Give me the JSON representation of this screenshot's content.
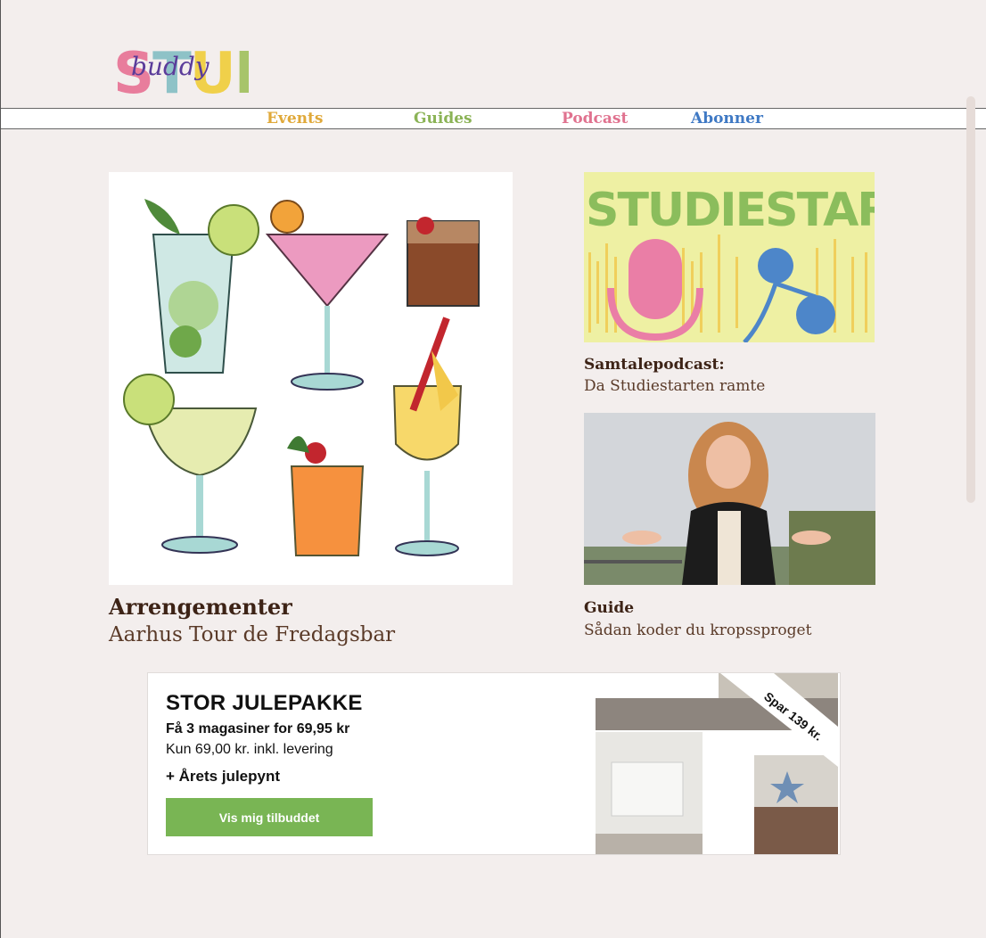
{
  "logo": {
    "text_top": "STUDY",
    "text_script": "buddy"
  },
  "nav": [
    {
      "label": "Events",
      "color": "#e0a93a"
    },
    {
      "label": "Guides",
      "color": "#8bb356"
    },
    {
      "label": "Podcast",
      "color": "#e0728f"
    },
    {
      "label": "Abonner",
      "color": "#3f79c4"
    }
  ],
  "featured": {
    "category": "Arrengementer",
    "title": "Aarhus Tour de Fredagsbar",
    "image_icon": "cocktails-illustration"
  },
  "podcast": {
    "image_text": "STUDIESTART",
    "category": "Samtalepodcast:",
    "title": "Da Studiestarten ramte"
  },
  "guide": {
    "category": "Guide",
    "title": "Sådan koder du kropssproget",
    "image_icon": "person-photo"
  },
  "ad": {
    "title": "STOR JULEPAKKE",
    "line1": "Få 3 magasiner for 69,95 kr",
    "line2": "Kun 69,00 kr. inkl. levering",
    "line3": "+ Årets julepynt",
    "button": "Vis mig tilbuddet",
    "ribbon": "Spar 139 kr.",
    "button_color": "#79b554"
  }
}
